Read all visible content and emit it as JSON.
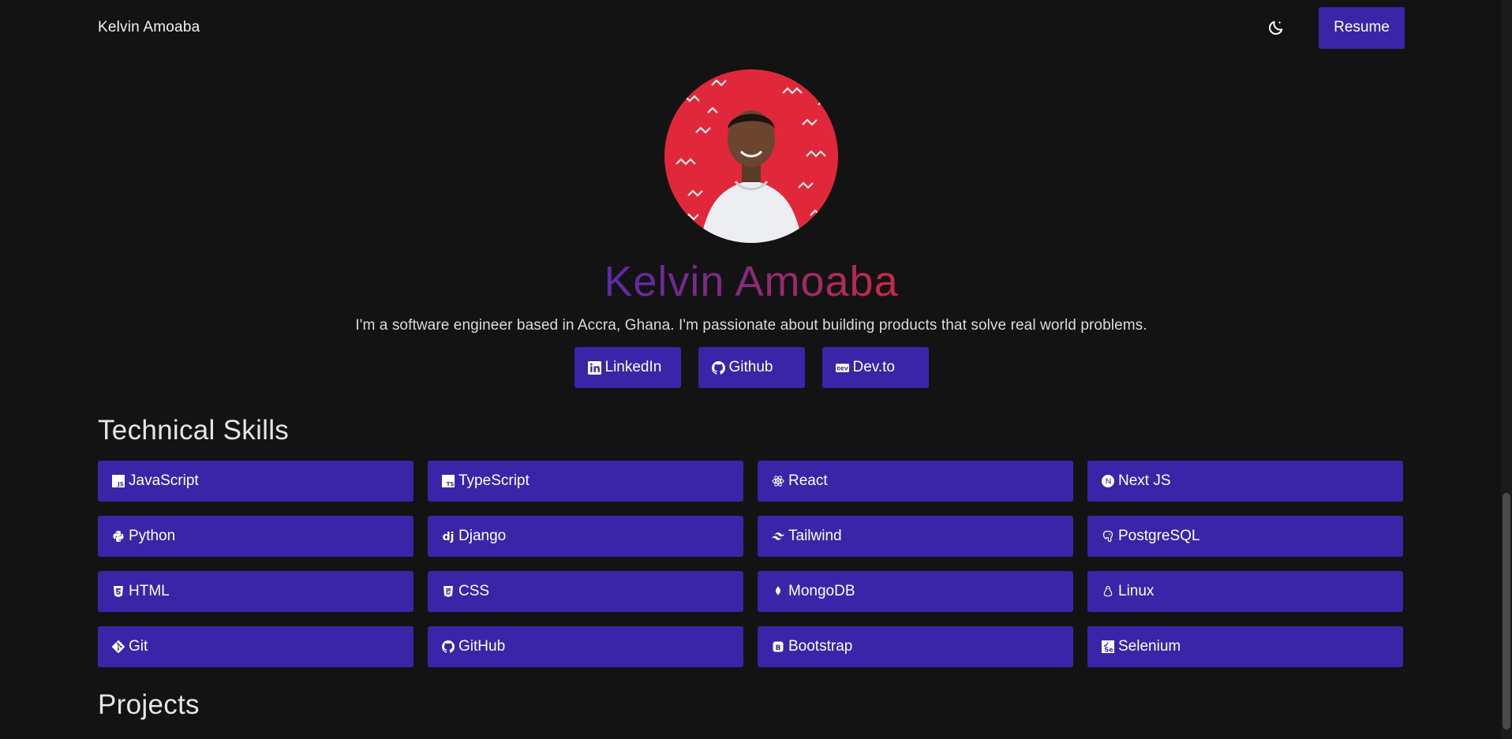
{
  "nav": {
    "brand": "Kelvin Amoaba",
    "theme_icon": "moon-icon",
    "resume_label": "Resume"
  },
  "hero": {
    "name": "Kelvin Amoaba",
    "bio": "I'm a software engineer based in Accra, Ghana. I'm passionate about building products that solve real world problems.",
    "avatar_icon": "profile-photo",
    "name_gradient": [
      "#5a2aa6",
      "#c82a44"
    ],
    "socials": [
      {
        "label": "LinkedIn",
        "icon": "linkedin-icon"
      },
      {
        "label": "Github",
        "icon": "github-icon"
      },
      {
        "label": "Dev.to",
        "icon": "devto-icon"
      }
    ]
  },
  "skills": {
    "title": "Technical Skills",
    "items": [
      {
        "label": "JavaScript",
        "icon": "javascript-icon"
      },
      {
        "label": "TypeScript",
        "icon": "typescript-icon"
      },
      {
        "label": "React",
        "icon": "react-icon"
      },
      {
        "label": "Next JS",
        "icon": "nextjs-icon"
      },
      {
        "label": "Python",
        "icon": "python-icon"
      },
      {
        "label": "Django",
        "icon": "django-icon"
      },
      {
        "label": "Tailwind",
        "icon": "tailwind-icon"
      },
      {
        "label": "PostgreSQL",
        "icon": "postgresql-icon"
      },
      {
        "label": "HTML",
        "icon": "html5-icon"
      },
      {
        "label": "CSS",
        "icon": "css3-icon"
      },
      {
        "label": "MongoDB",
        "icon": "mongodb-icon"
      },
      {
        "label": "Linux",
        "icon": "linux-icon"
      },
      {
        "label": "Git",
        "icon": "git-icon"
      },
      {
        "label": "GitHub",
        "icon": "github-icon"
      },
      {
        "label": "Bootstrap",
        "icon": "bootstrap-icon"
      },
      {
        "label": "Selenium",
        "icon": "selenium-icon"
      }
    ]
  },
  "projects": {
    "title": "Projects"
  },
  "colors": {
    "background": "#131313",
    "accent": "#3a24a8",
    "text": "#e8e8e8"
  }
}
